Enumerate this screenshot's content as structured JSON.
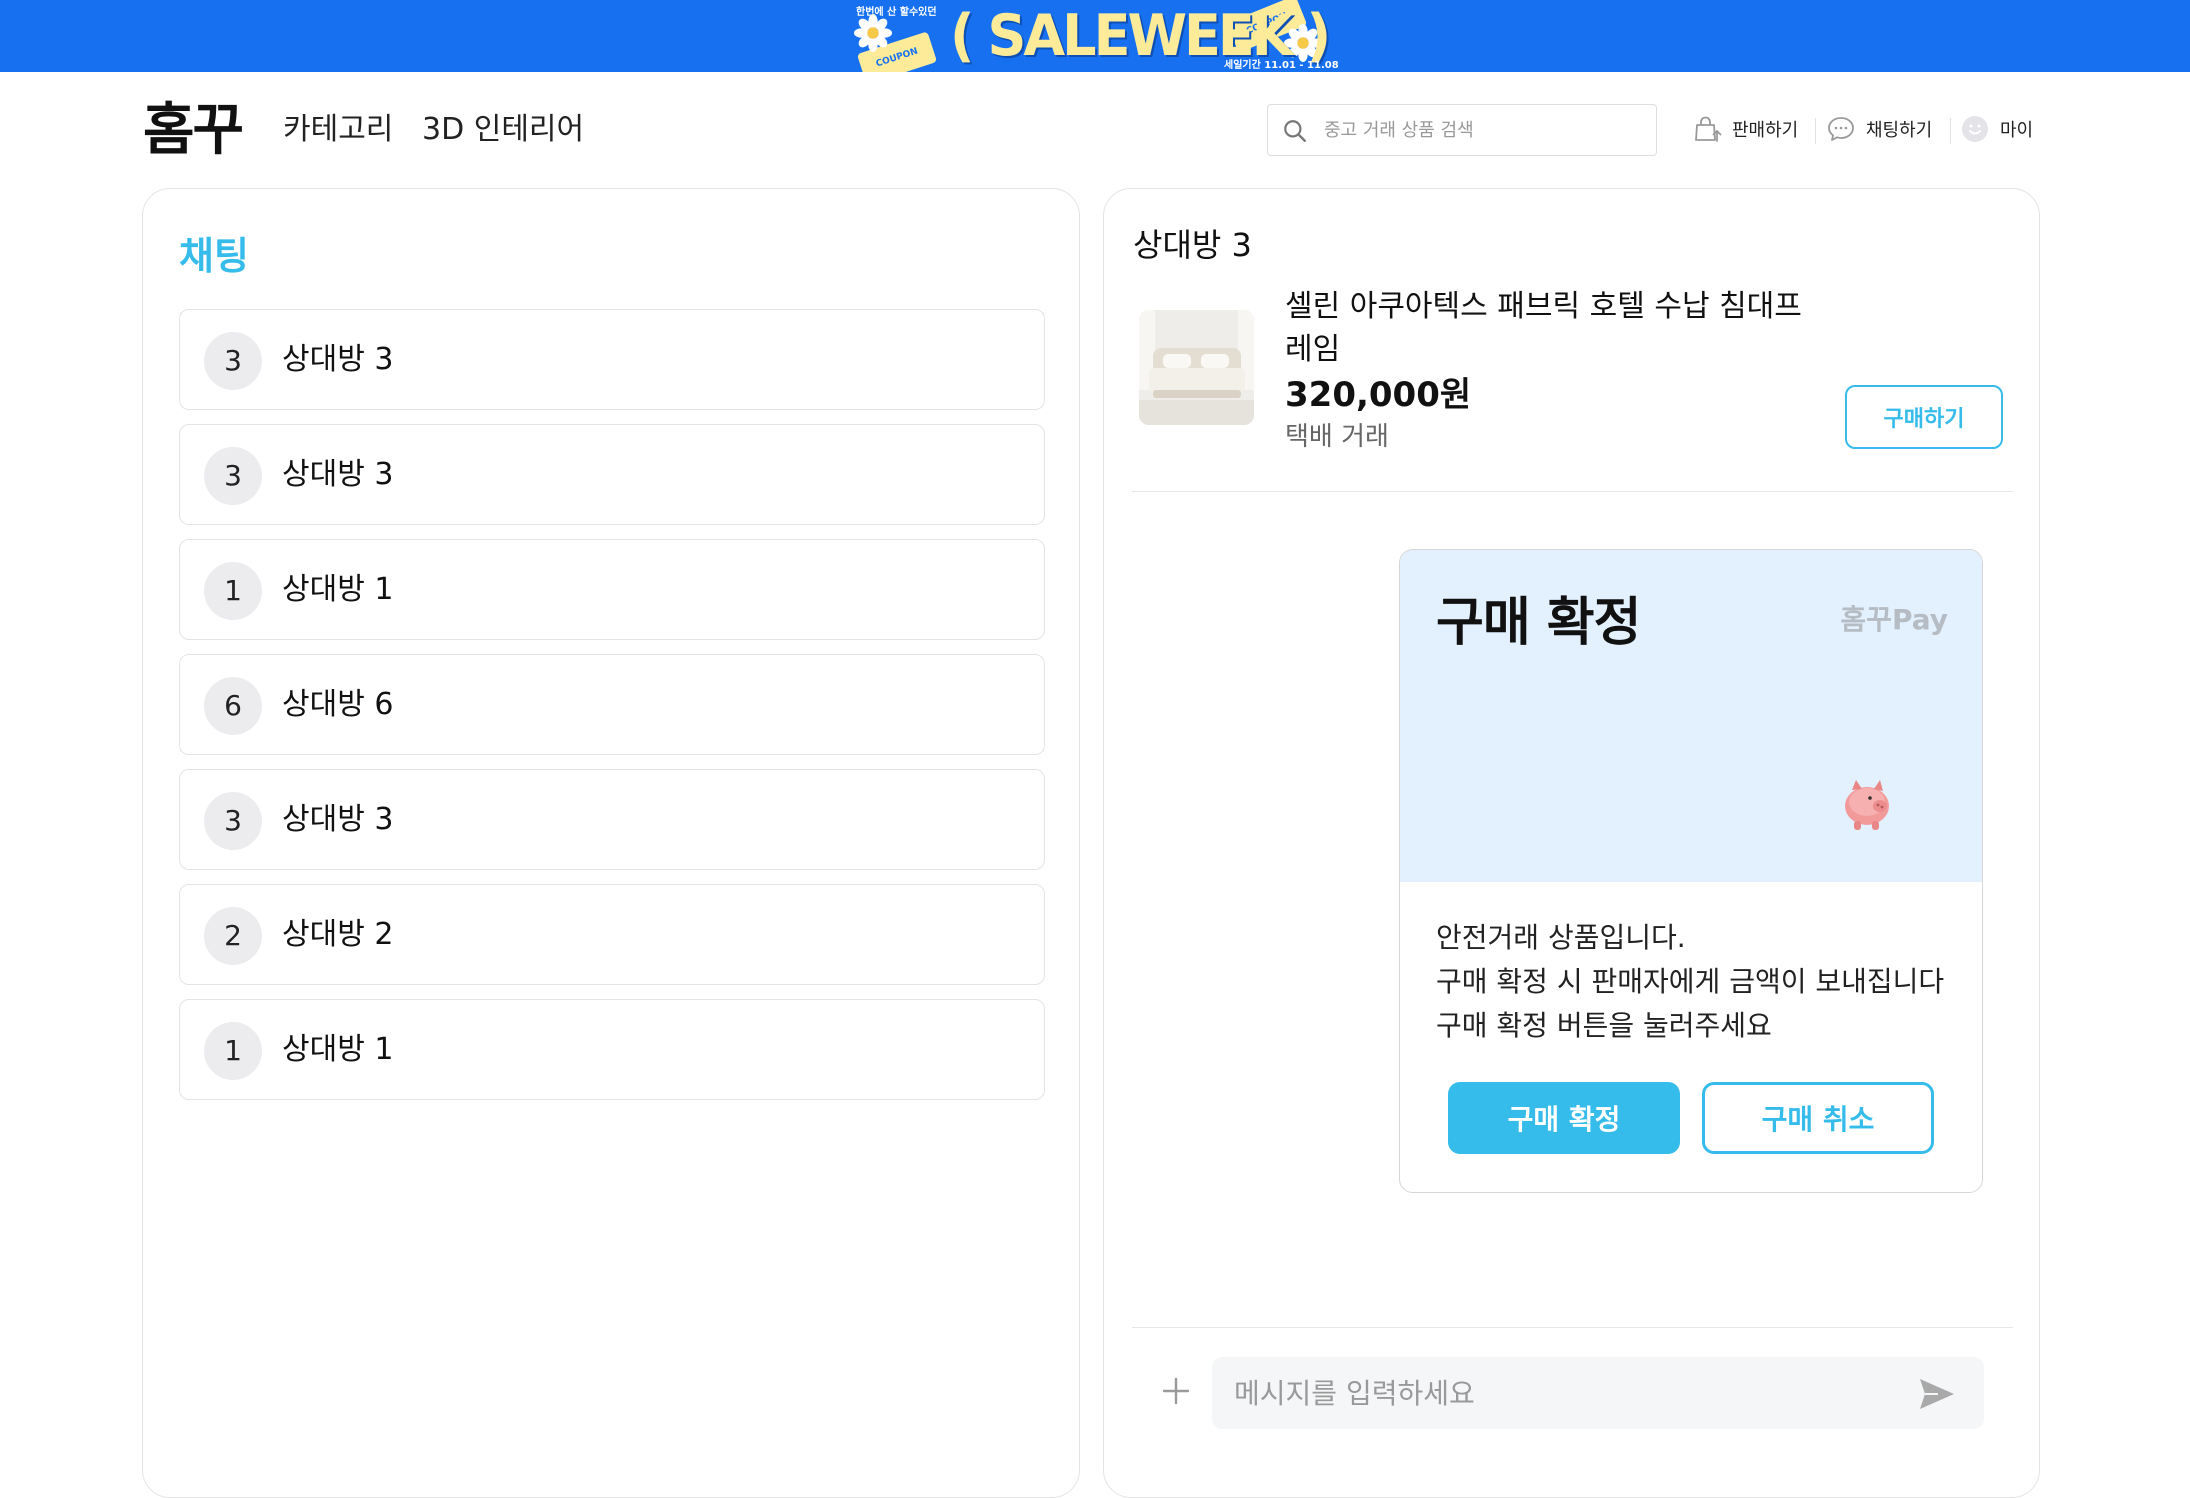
{
  "banner": {
    "top_text": "한번에 산 할수있던",
    "title": "( SALEWEEK )",
    "coupon_label": "COUPON",
    "period_text": "세일기간 11.01 - 11.08",
    "colors": {
      "background": "#1670F0",
      "title": "#FDEB9A"
    }
  },
  "header": {
    "logo": "홈꾸",
    "nav": {
      "category": "카테고리",
      "interior_3d": "3D 인테리어"
    },
    "search": {
      "placeholder": "중고 거래 상품 검색",
      "value": ""
    },
    "actions": {
      "sell": "판매하기",
      "chat": "채팅하기",
      "my": "마이"
    },
    "icons": [
      "search-icon",
      "sell-bag-icon",
      "chat-bubble-icon",
      "smile-avatar-icon"
    ]
  },
  "chat_list": {
    "title": "채팅",
    "rooms": [
      {
        "badge": "3",
        "name": "상대방 3"
      },
      {
        "badge": "3",
        "name": "상대방 3"
      },
      {
        "badge": "1",
        "name": "상대방 1"
      },
      {
        "badge": "6",
        "name": "상대방 6"
      },
      {
        "badge": "3",
        "name": "상대방 3"
      },
      {
        "badge": "2",
        "name": "상대방 2"
      },
      {
        "badge": "1",
        "name": "상대방 1"
      }
    ]
  },
  "chat_room": {
    "title": "상대방 3",
    "product": {
      "title": "셀린 아쿠아텍스 패브릭 호텔 수납 침대프레임",
      "price": "320,000원",
      "delivery": "택배 거래",
      "buy_label": "구매하기"
    },
    "confirm_card": {
      "title": "구매 확정",
      "brand": "홈꾸Pay",
      "message_lines": [
        "안전거래 상품입니다.",
        "구매 확정 시 판매자에게 금액이 보내집니다",
        "구매 확정 버튼을 눌러주세요"
      ],
      "confirm_label": "구매 확정",
      "cancel_label": "구매 취소"
    },
    "composer": {
      "placeholder": "메시지를 입력하세요",
      "value": ""
    }
  },
  "colors": {
    "accent": "#35BCEB",
    "card_header_bg": "#E3F1FE"
  }
}
